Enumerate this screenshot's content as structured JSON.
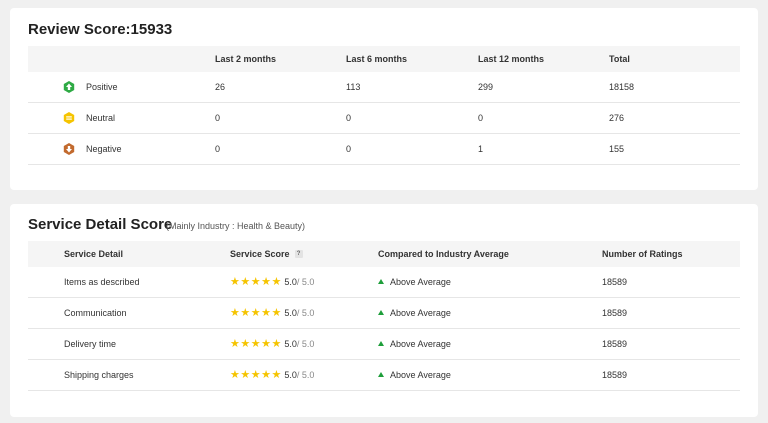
{
  "review": {
    "title": "Review Score:15933",
    "headers": [
      "",
      "Last 2 months",
      "Last 6 months",
      "Last 12 months",
      "Total"
    ],
    "rows": [
      {
        "label": "Positive",
        "icon": "positive-icon",
        "color": "#2eaa44",
        "v": [
          "26",
          "113",
          "299",
          "18158"
        ]
      },
      {
        "label": "Neutral",
        "icon": "neutral-icon",
        "color": "#f5c400",
        "v": [
          "0",
          "0",
          "0",
          "276"
        ]
      },
      {
        "label": "Negative",
        "icon": "negative-icon",
        "color": "#c26a2e",
        "v": [
          "0",
          "0",
          "1",
          "155"
        ]
      }
    ]
  },
  "detail": {
    "title": "Service Detail Score",
    "subtitle": "(Mainly Industry : Health & Beauty)",
    "headers": [
      "Service Detail",
      "Service Score",
      "Compared to Industry Average",
      "Number of Ratings"
    ],
    "help": "?",
    "rows": [
      {
        "label": "Items as described",
        "stars": "★★★★★",
        "score": "5.0",
        "max": "/ 5.0",
        "compare": "Above Average",
        "count": "18589"
      },
      {
        "label": "Communication",
        "stars": "★★★★★",
        "score": "5.0",
        "max": "/ 5.0",
        "compare": "Above Average",
        "count": "18589"
      },
      {
        "label": "Delivery time",
        "stars": "★★★★★",
        "score": "5.0",
        "max": "/ 5.0",
        "compare": "Above Average",
        "count": "18589"
      },
      {
        "label": "Shipping charges",
        "stars": "★★★★★",
        "score": "5.0",
        "max": "/ 5.0",
        "compare": "Above Average",
        "count": "18589"
      }
    ],
    "star_color": "#f5c400",
    "arrow_color": "#1e9e3a"
  }
}
